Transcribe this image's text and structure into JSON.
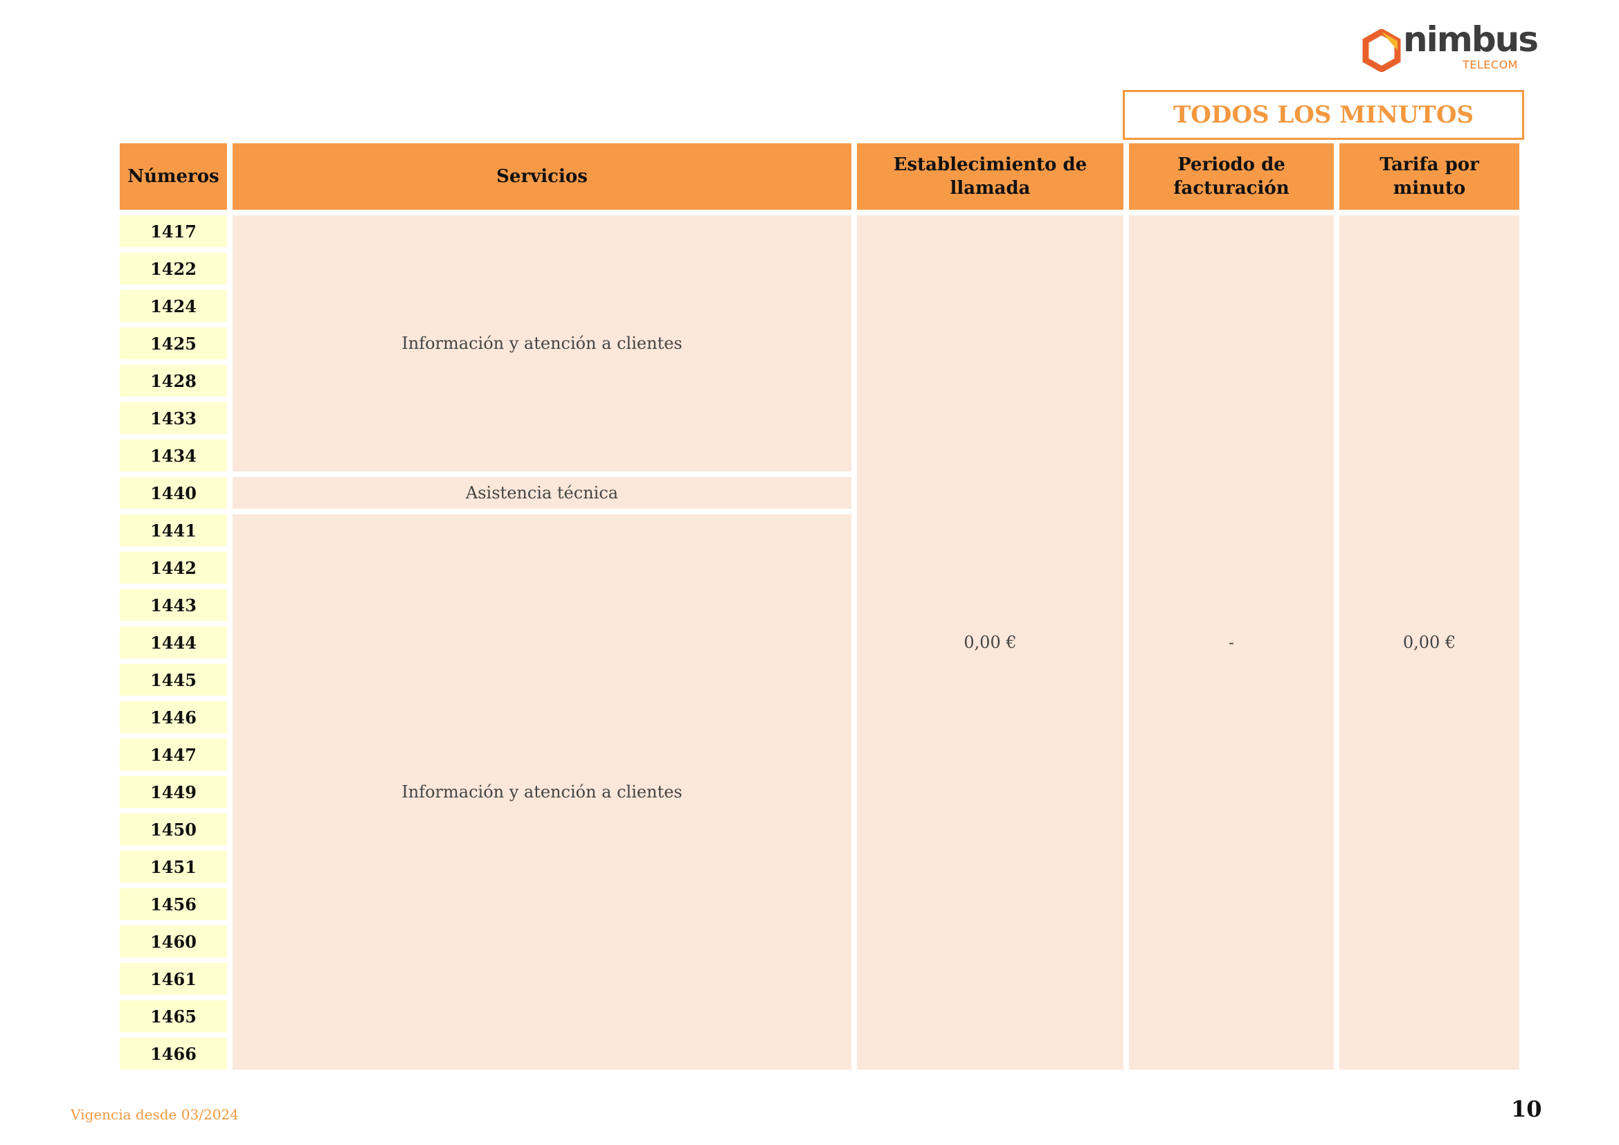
{
  "logo": {
    "word": "nimbus",
    "sub": "TELECOM",
    "accent": "#f07f27"
  },
  "banner": {
    "title": "TODOS LOS MINUTOS"
  },
  "table": {
    "headers": [
      "Números",
      "Servicios",
      "Establecimiento de llamada",
      "Periodo de facturación",
      "Tarifa por minuto"
    ],
    "numbers": [
      "1417",
      "1422",
      "1424",
      "1425",
      "1428",
      "1433",
      "1434",
      "1440",
      "1441",
      "1442",
      "1443",
      "1444",
      "1445",
      "1446",
      "1447",
      "1449",
      "1450",
      "1451",
      "1456",
      "1460",
      "1461",
      "1465",
      "1466"
    ],
    "services": [
      {
        "label": "Información y atención a clientes",
        "rows": 7
      },
      {
        "label": "Asistencia técnica",
        "rows": 1
      },
      {
        "label": "Información y atención a clientes",
        "rows": 15
      }
    ],
    "establishment": "0,00 €",
    "billing_period": "-",
    "rate_per_minute": "0,00 €"
  },
  "footer": {
    "validity": "Vigencia desde 03/2024",
    "page_number": "10"
  },
  "colors": {
    "header": "#f79a48",
    "number_cell": "#ffffd0",
    "body_cell": "#fce8da",
    "banner_border": "#f3983f"
  }
}
